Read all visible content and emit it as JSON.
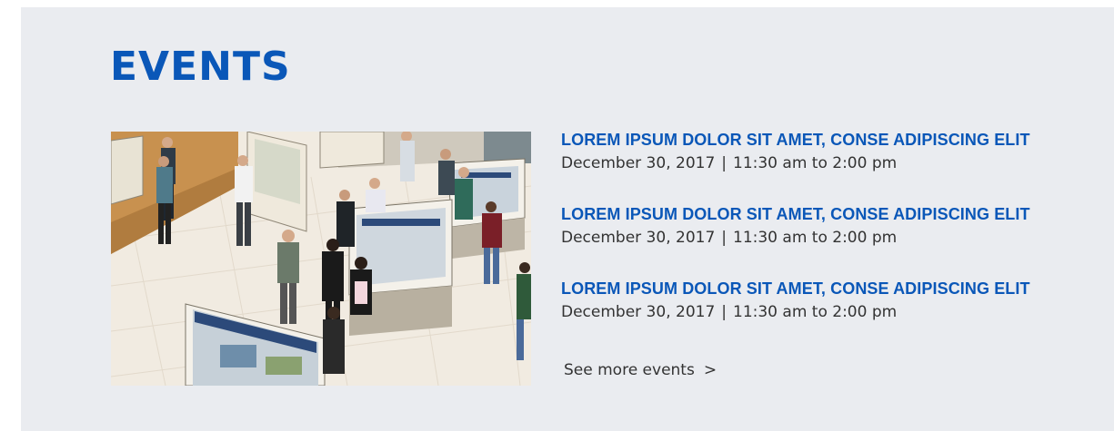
{
  "section": {
    "title": "EVENTS"
  },
  "events": [
    {
      "title": "LOREM IPSUM DOLOR SIT AMET, CONSE ADIPISCING ELIT",
      "date": "December 30, 2017",
      "separator": "|",
      "time": "11:30 am to 2:00 pm"
    },
    {
      "title": "LOREM IPSUM DOLOR SIT AMET, CONSE ADIPISCING ELIT",
      "date": "December 30, 2017",
      "separator": "|",
      "time": "11:30 am to 2:00 pm"
    },
    {
      "title": "LOREM IPSUM DOLOR SIT AMET, CONSE ADIPISCING ELIT",
      "date": "December 30, 2017",
      "separator": "|",
      "time": "11:30 am to 2:00 pm"
    }
  ],
  "see_more": {
    "label": "See more events",
    "chevron": ">"
  },
  "colors": {
    "accent": "#0a57b8",
    "panel_bg": "#eaecf0",
    "text": "#333333"
  }
}
